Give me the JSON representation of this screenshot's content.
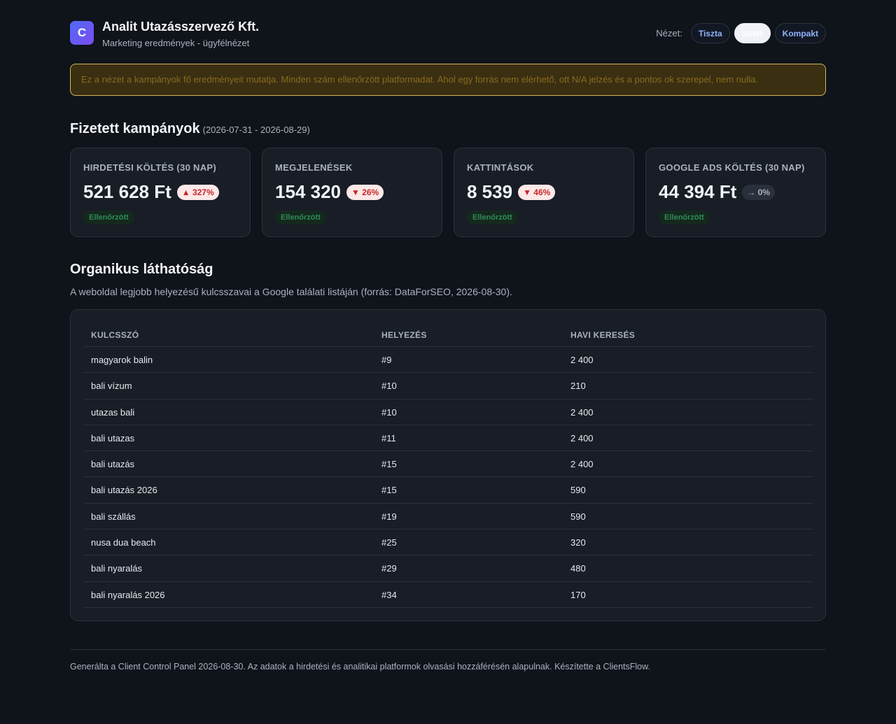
{
  "header": {
    "logo_letter": "C",
    "title": "Analit Utazásszervező Kft.",
    "subtitle": "Marketing eredmények - ügyfélnézet",
    "view_label": "Nézet:",
    "view_options": [
      "Tiszta",
      "Sötét",
      "Kompakt"
    ],
    "view_selected": "Sötét"
  },
  "notice": "Ez a nézet a kampányok fő eredményeit mutatja. Minden szám ellenőrzött platformadat. Ahol egy forrás nem elérhető, ott N/A jelzés és a pontos ok szerepel, nem nulla.",
  "paid": {
    "title": "Fizetett kampányok",
    "range": "(2026-07-31 - 2026-08-29)",
    "cards": [
      {
        "label": "HIRDETÉSI KÖLTÉS (30 NAP)",
        "value": "521 628 Ft",
        "delta": "▲ 327%",
        "delta_type": "neg",
        "badge": "Ellenőrzött"
      },
      {
        "label": "MEGJELENÉSEK",
        "value": "154 320",
        "delta": "▼ 26%",
        "delta_type": "neg",
        "badge": "Ellenőrzött"
      },
      {
        "label": "KATTINTÁSOK",
        "value": "8 539",
        "delta": "▼ 46%",
        "delta_type": "neg",
        "badge": "Ellenőrzött"
      },
      {
        "label": "GOOGLE ADS KÖLTÉS (30 NAP)",
        "value": "44 394 Ft",
        "delta": "→ 0%",
        "delta_type": "flat",
        "badge": "Ellenőrzött"
      }
    ]
  },
  "organic": {
    "title": "Organikus láthatóság",
    "description": "A weboldal legjobb helyezésű kulcsszavai a Google találati listáján (forrás: DataForSEO, 2026-08-30).",
    "columns": [
      "KULCSSZÓ",
      "HELYEZÉS",
      "HAVI KERESÉS"
    ],
    "rows": [
      [
        "magyarok balin",
        "#9",
        "2 400"
      ],
      [
        "bali vízum",
        "#10",
        "210"
      ],
      [
        "utazas bali",
        "#10",
        "2 400"
      ],
      [
        "bali utazas",
        "#11",
        "2 400"
      ],
      [
        "bali utazás",
        "#15",
        "2 400"
      ],
      [
        "bali utazás 2026",
        "#15",
        "590"
      ],
      [
        "bali szállás",
        "#19",
        "590"
      ],
      [
        "nusa dua beach",
        "#25",
        "320"
      ],
      [
        "bali nyaralás",
        "#29",
        "480"
      ],
      [
        "bali nyaralás 2026",
        "#34",
        "170"
      ]
    ]
  },
  "footer": "Generálta a Client Control Panel 2026-08-30. Az adatok a hirdetési és analitikai platformok olvasási hozzáférésén alapulnak. Készítette a ClientsFlow."
}
